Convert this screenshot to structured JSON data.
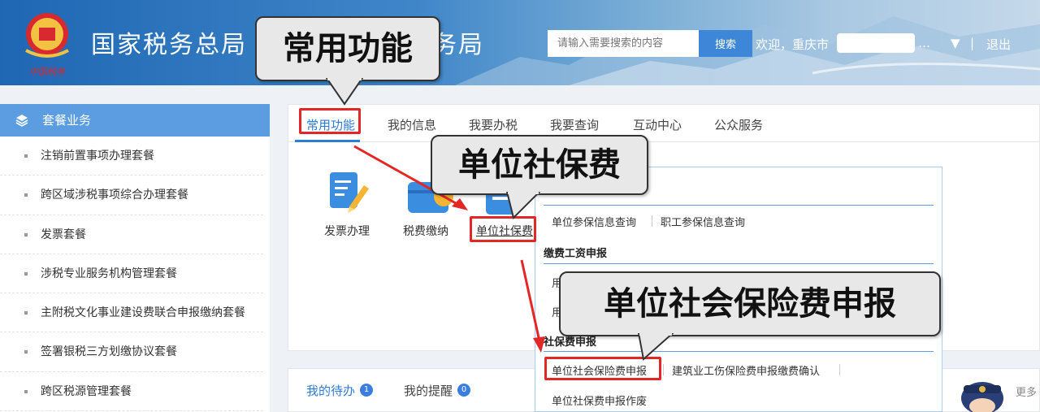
{
  "header": {
    "title": "国家税务总局",
    "title_suffix": "务局",
    "search_placeholder": "请输入需要搜索的内容",
    "search_button": "搜索",
    "welcome": "欢迎，重庆市",
    "ellipsis": "…",
    "dropdown_glyph": "▼",
    "divider": "|",
    "logout": "退出",
    "emblem_text": "中国税务"
  },
  "callouts": {
    "common": "常用功能",
    "social_fee": "单位社保费",
    "declare": "单位社会保险费申报"
  },
  "sidebar": {
    "title": "套餐业务",
    "items": [
      "注销前置事项办理套餐",
      "跨区域涉税事项综合办理套餐",
      "发票套餐",
      "涉税专业服务机构管理套餐",
      "主附税文化事业建设费联合申报缴纳套餐",
      "签署银税三方划缴协议套餐",
      "跨区税源管理套餐"
    ]
  },
  "tabs": [
    "常用功能",
    "我的信息",
    "我要办税",
    "我要查询",
    "互动中心",
    "公众服务"
  ],
  "apps": [
    {
      "label": "发票办理"
    },
    {
      "label": "税费缴纳"
    },
    {
      "label": "单位社保费"
    }
  ],
  "dropdown": {
    "links_row1": [
      "单位参保信息查询",
      "职工参保信息查询"
    ],
    "section_wage": "缴费工资申报",
    "wage_item_1": "用",
    "wage_item_2": "用",
    "section_social": "社保费申报",
    "links_row2": [
      "单位社会保险费申报",
      "建筑业工伤保险费申报缴费确认"
    ],
    "link_cancel": "单位社保费申报作废"
  },
  "lower": {
    "tabs": [
      {
        "label": "我的待办",
        "badge": "1"
      },
      {
        "label": "我的提醒",
        "badge": "0"
      }
    ],
    "more": "更多"
  },
  "colors": {
    "accent": "#2f7bd8",
    "highlight": "#e32626",
    "sidebar_head": "#5b9de0"
  }
}
